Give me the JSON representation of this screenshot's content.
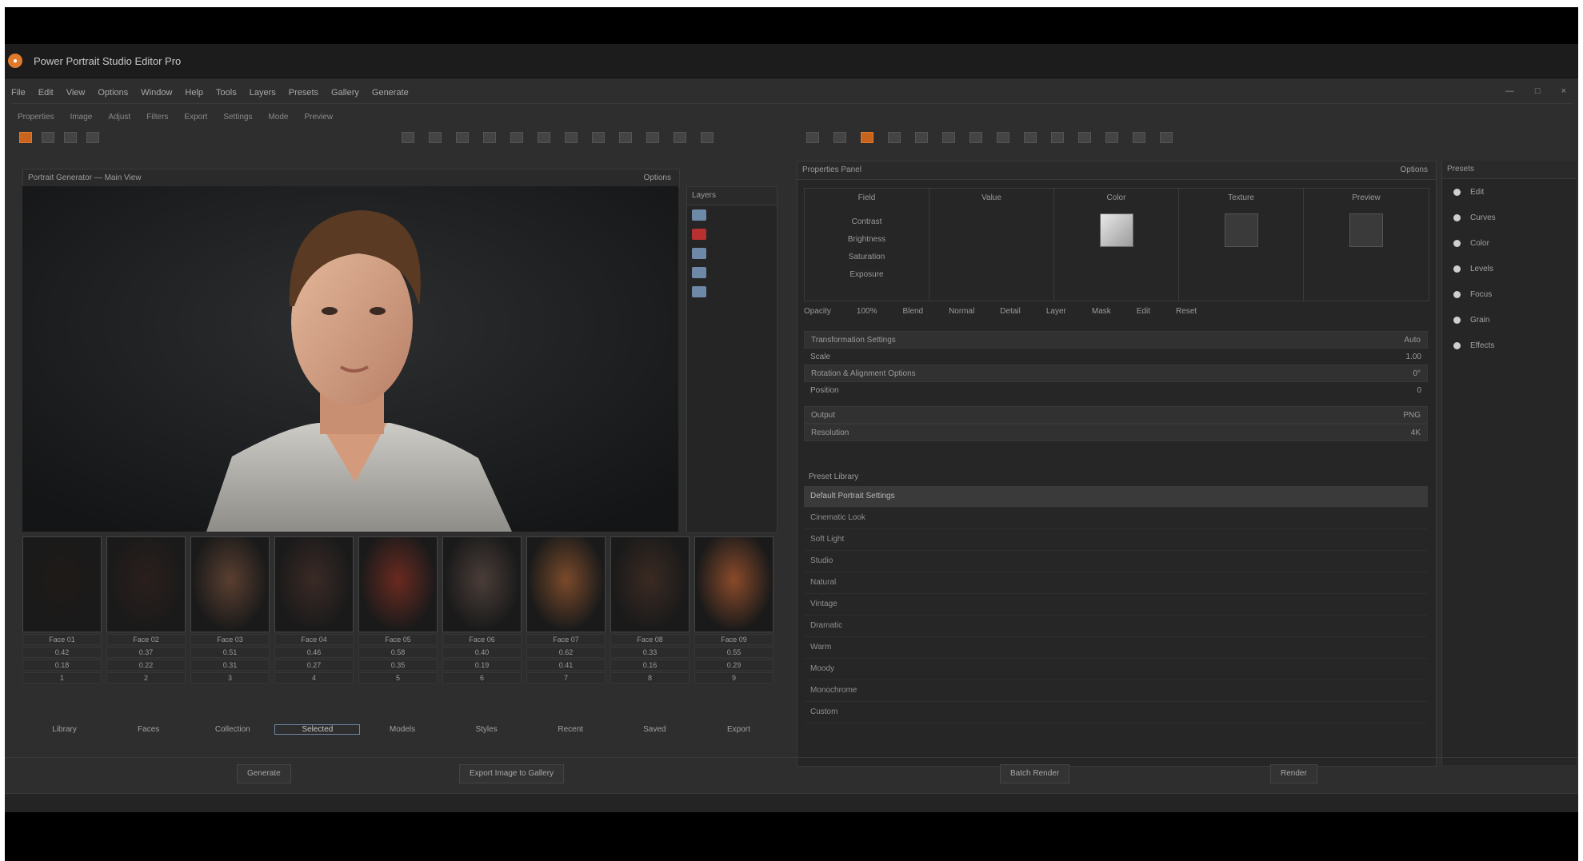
{
  "titlebar": {
    "title": "Power Portrait Studio Editor Pro"
  },
  "menu": {
    "items": [
      "File",
      "Edit",
      "View",
      "Options",
      "Window",
      "Help",
      "Tools",
      "Layers",
      "Presets",
      "Gallery",
      "Generate"
    ],
    "right": [
      "—",
      "□",
      "×"
    ]
  },
  "toolbar": {
    "items": [
      "Properties",
      "Image",
      "Adjust",
      "Filters",
      "Export",
      "Settings",
      "Mode",
      "Preview"
    ]
  },
  "viewer": {
    "title": "Portrait Generator — Main View",
    "header_right": "Options",
    "side_title": "Layers"
  },
  "thumbnails": [
    {
      "label": "Face 01",
      "v1": "0.42",
      "v2": "0.18",
      "v3": "1"
    },
    {
      "label": "Face 02",
      "v1": "0.37",
      "v2": "0.22",
      "v3": "2"
    },
    {
      "label": "Face 03",
      "v1": "0.51",
      "v2": "0.31",
      "v3": "3"
    },
    {
      "label": "Face 04",
      "v1": "0.46",
      "v2": "0.27",
      "v3": "4"
    },
    {
      "label": "Face 05",
      "v1": "0.58",
      "v2": "0.35",
      "v3": "5"
    },
    {
      "label": "Face 06",
      "v1": "0.40",
      "v2": "0.19",
      "v3": "6"
    },
    {
      "label": "Face 07",
      "v1": "0.62",
      "v2": "0.41",
      "v3": "7"
    },
    {
      "label": "Face 08",
      "v1": "0.33",
      "v2": "0.16",
      "v3": "8"
    },
    {
      "label": "Face 09",
      "v1": "0.55",
      "v2": "0.29",
      "v3": "9"
    }
  ],
  "tabs": [
    "Library",
    "Faces",
    "Collection",
    "Selected",
    "Models",
    "Styles",
    "Recent",
    "Saved",
    "Export"
  ],
  "properties_panel": {
    "title": "Properties Panel",
    "right": "Options",
    "columns": [
      "Field",
      "Value",
      "Color",
      "Texture",
      "Preview"
    ],
    "rows": [
      "Contrast",
      "Brightness",
      "Saturation",
      "Exposure"
    ],
    "footer": [
      "Opacity",
      "100%",
      "Blend",
      "Normal",
      "Detail",
      "Layer",
      "Mask",
      "Edit",
      "Reset"
    ]
  },
  "settings": [
    {
      "label": "Transformation Settings",
      "value": "Auto"
    },
    {
      "label": "Scale",
      "value": "1.00"
    },
    {
      "label": "Rotation & Alignment Options",
      "value": "0°"
    },
    {
      "label": "Position",
      "value": "0"
    },
    {
      "label": "Output",
      "value": "PNG"
    },
    {
      "label": "Resolution",
      "value": "4K"
    }
  ],
  "preset_list": {
    "title": "Preset Library",
    "items": [
      "Default Portrait Settings",
      "Cinematic Look",
      "Soft Light",
      "Studio",
      "Natural",
      "Vintage",
      "Dramatic",
      "Warm",
      "Moody",
      "Monochrome",
      "Custom"
    ]
  },
  "far_right": {
    "header": "Presets",
    "rows": [
      "Edit",
      "Curves",
      "Color",
      "Levels",
      "Focus",
      "Grain",
      "Effects"
    ]
  },
  "bottom": {
    "left_button": "Generate",
    "center_button": "Export Image to Gallery",
    "right_button": "Batch Render",
    "far_button": "Render"
  }
}
